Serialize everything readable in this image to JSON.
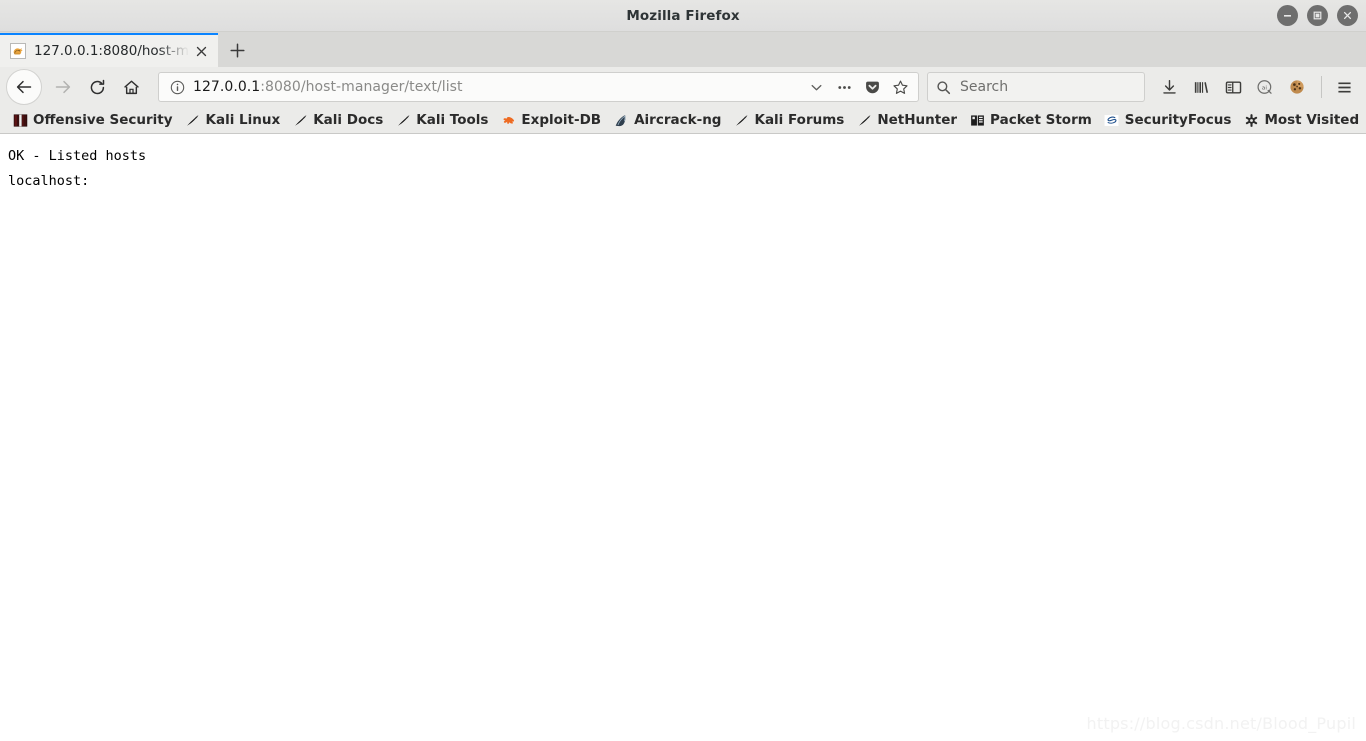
{
  "window": {
    "title": "Mozilla Firefox",
    "controls": [
      {
        "name": "minimize",
        "glyph": "minimize"
      },
      {
        "name": "maximize",
        "glyph": "maximize"
      },
      {
        "name": "close",
        "glyph": "close"
      }
    ],
    "chrome_colors": {
      "titlebar": "#dedede",
      "tabstrip": "#d8d8d6",
      "toolbar": "#ebebe9",
      "active_tab": "#f0f0ee",
      "tab_accent": "#0a84ff",
      "content": "#ffffff"
    }
  },
  "tabs": {
    "items": [
      {
        "title": "127.0.0.1:8080/host-ma",
        "favicon": "tomcat-icon",
        "active": true,
        "close_label": "✕"
      }
    ],
    "new_tab_label": "+"
  },
  "navigation": {
    "back": {
      "name": "back-button",
      "title": "Back",
      "enabled": true
    },
    "forward": {
      "name": "forward-button",
      "title": "Forward",
      "enabled": false
    },
    "reload": {
      "name": "reload-button",
      "title": "Reload"
    },
    "home": {
      "name": "home-button",
      "title": "Home"
    }
  },
  "url_bar": {
    "identity_icon": "info-icon",
    "host": "127.0.0.1",
    "path": ":8080/host-manager/text/list",
    "full_url": "127.0.0.1:8080/host-manager/text/list",
    "actions": [
      {
        "name": "history-dropdown-icon",
        "glyph": "chevron-down"
      },
      {
        "name": "page-actions-icon",
        "glyph": "ellipsis"
      },
      {
        "name": "pocket-icon",
        "glyph": "pocket"
      },
      {
        "name": "bookmark-star-icon",
        "glyph": "star"
      }
    ]
  },
  "search": {
    "placeholder": "Search",
    "icon": "search-icon",
    "value": ""
  },
  "toolbar_right": {
    "items": [
      {
        "name": "downloads-icon",
        "glyph": "download"
      },
      {
        "name": "library-icon",
        "glyph": "library"
      },
      {
        "name": "sidebar-icon",
        "glyph": "sidebar"
      },
      {
        "name": "qa-addon-icon",
        "glyph": "qa-circle"
      },
      {
        "name": "cookie-addon-icon",
        "glyph": "cookie"
      },
      {
        "name": "app-menu-icon",
        "glyph": "hamburger"
      }
    ]
  },
  "bookmarks": {
    "items": [
      {
        "label": "Offensive Security",
        "icon": "offensive-security-icon"
      },
      {
        "label": "Kali Linux",
        "icon": "kali-dragon-icon"
      },
      {
        "label": "Kali Docs",
        "icon": "kali-dragon-icon"
      },
      {
        "label": "Kali Tools",
        "icon": "kali-dragon-icon"
      },
      {
        "label": "Exploit-DB",
        "icon": "exploit-db-icon"
      },
      {
        "label": "Aircrack-ng",
        "icon": "aircrack-ng-icon"
      },
      {
        "label": "Kali Forums",
        "icon": "kali-dragon-icon"
      },
      {
        "label": "NetHunter",
        "icon": "kali-dragon-icon"
      },
      {
        "label": "Packet Storm",
        "icon": "packet-storm-icon"
      },
      {
        "label": "SecurityFocus",
        "icon": "securityfocus-icon"
      },
      {
        "label": "Most Visited",
        "icon": "most-visited-icon"
      }
    ],
    "overflow_label": "»"
  },
  "page": {
    "line1": "OK - Listed hosts",
    "line2": "localhost:",
    "watermark": "https://blog.csdn.net/Blood_Pupil"
  }
}
